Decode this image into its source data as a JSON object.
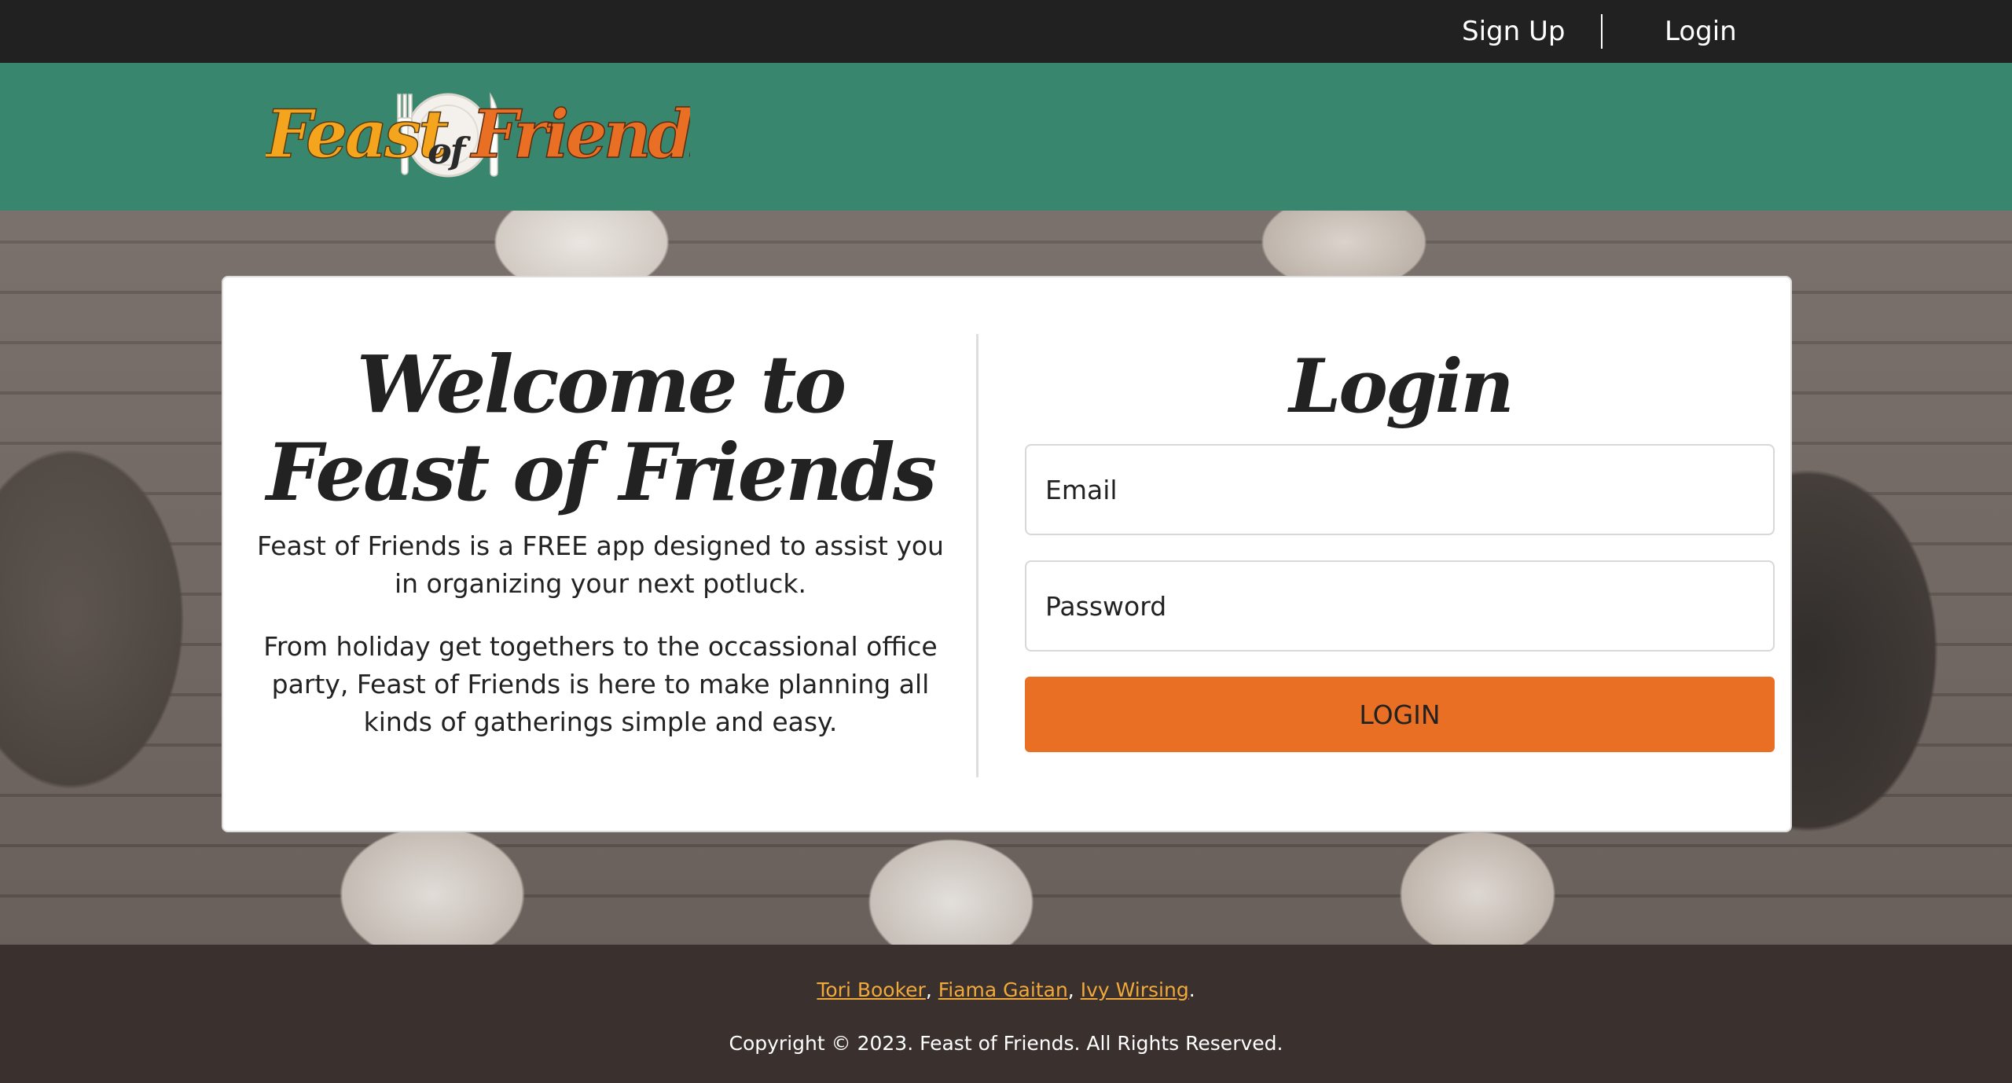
{
  "nav": {
    "signup_label": "Sign Up",
    "login_label": "Login"
  },
  "brand": {
    "logo_word_1": "Feast",
    "logo_word_2": "of",
    "logo_word_3": "Friends",
    "logo_colors": {
      "primary": "#f5a51d",
      "secondary": "#e96f24"
    },
    "header_color": "#37866d"
  },
  "welcome": {
    "heading_line_1": "Welcome to",
    "heading_line_2": "Feast of Friends",
    "paragraph_1": "Feast of Friends is a FREE app designed to assist you in organizing your next potluck.",
    "paragraph_2": "From holiday get togethers to the occassional office party, Feast of Friends is here to make planning all kinds of gatherings simple and easy."
  },
  "login_form": {
    "title": "Login",
    "email_placeholder": "Email",
    "email_value": "",
    "password_placeholder": "Password",
    "password_value": "",
    "submit_label": "LOGIN",
    "submit_color": "#e96f24"
  },
  "footer": {
    "authors": [
      "Tori Booker",
      "Fiama Gaitan",
      "Ivy Wirsing"
    ],
    "separator": ", ",
    "terminator": ".",
    "copyright": "Copyright © 2023. Feast of Friends. All Rights Reserved.",
    "link_color": "#f2a93b"
  }
}
